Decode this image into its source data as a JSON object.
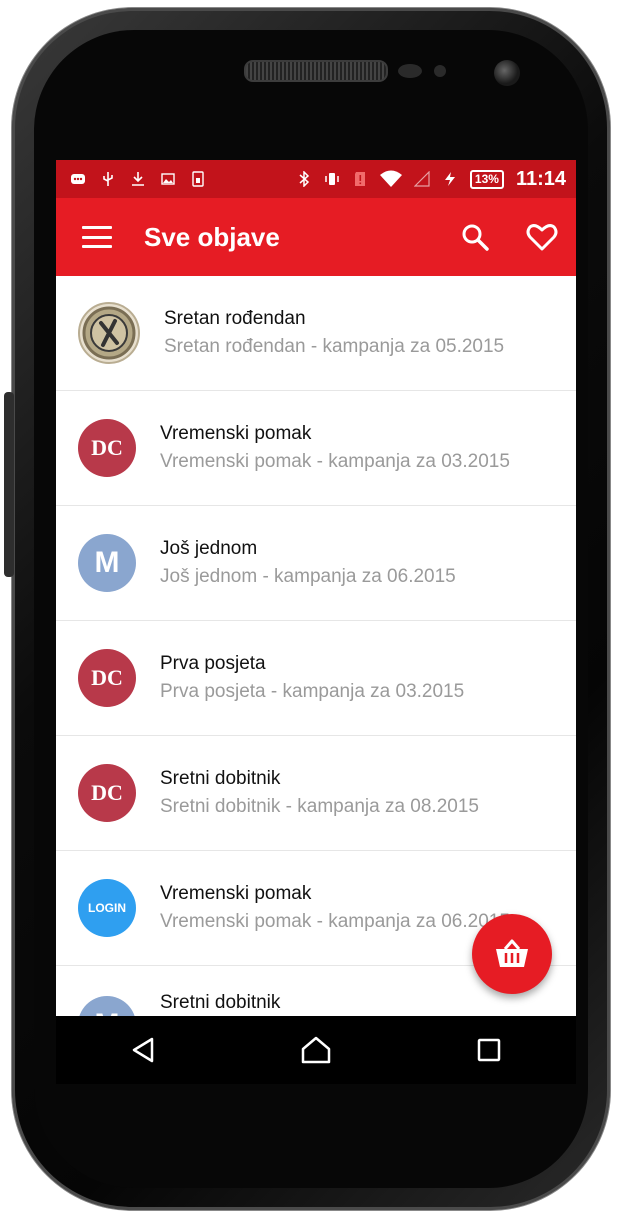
{
  "status_bar": {
    "time": "11:14",
    "battery": "13%",
    "icons": [
      "chat-icon",
      "usb-icon",
      "download-icon",
      "image-icon",
      "sim-icon",
      "bluetooth-icon",
      "vibrate-icon",
      "sd-alert-icon",
      "wifi-icon",
      "signal-icon",
      "charging-icon"
    ]
  },
  "app_bar": {
    "title": "Sve objave",
    "icons": [
      "menu-icon",
      "search-icon",
      "heart-icon"
    ]
  },
  "posts": [
    {
      "title": "Sretan rođendan",
      "subtitle": "Sretan rođendan - kampanja za 05.2015",
      "avatar": "restaurant-logo"
    },
    {
      "title": "Vremenski pomak",
      "subtitle": "Vremenski pomak - kampanja za 03.2015",
      "avatar_text": "DC"
    },
    {
      "title": "Još jednom",
      "subtitle": "Još jednom - kampanja za 06.2015",
      "avatar_text": "M"
    },
    {
      "title": "Prva posjeta",
      "subtitle": "Prva posjeta - kampanja za 03.2015",
      "avatar_text": "DC"
    },
    {
      "title": "Sretni dobitnik",
      "subtitle": "Sretni dobitnik - kampanja za 08.2015",
      "avatar_text": "DC"
    },
    {
      "title": "Vremenski pomak",
      "subtitle": "Vremenski pomak - kampanja za 06.2015",
      "avatar_text": "LOGIN"
    },
    {
      "title": "Sretni dobitnik",
      "subtitle": "",
      "avatar_text": "M"
    }
  ],
  "fab": {
    "icon": "basket-icon"
  },
  "nav_bar": {
    "icons": [
      "back-icon",
      "home-icon",
      "recents-icon"
    ]
  },
  "colors": {
    "primary": "#e61c24",
    "status_bar": "#c2131b",
    "dc_avatar": "#b8394a",
    "m_avatar": "#8aa6cf",
    "login_avatar": "#2f9ff0"
  }
}
